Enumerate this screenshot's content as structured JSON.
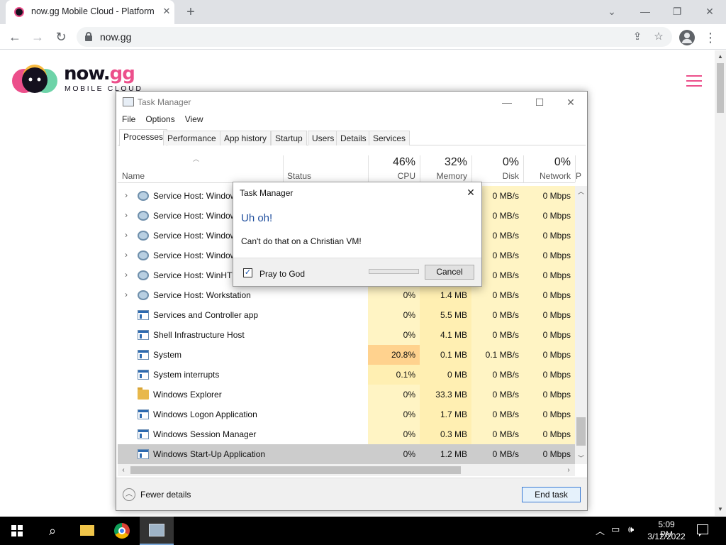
{
  "browser": {
    "tab_title": "now.gg Mobile Cloud - Platform",
    "tab_close": "✕",
    "new_tab": "+",
    "url": "now.gg",
    "window_controls": {
      "dropdown": "⌄",
      "minimize": "—",
      "restore": "❐",
      "close": "✕"
    }
  },
  "page": {
    "logo_main": "now.",
    "logo_accent": "gg",
    "logo_sub": "MOBILE CLOUD"
  },
  "task_manager": {
    "title": "Task Manager",
    "menu": [
      "File",
      "Options",
      "View"
    ],
    "tabs": [
      "Processes",
      "Performance",
      "App history",
      "Startup",
      "Users",
      "Details",
      "Services"
    ],
    "active_tab": "Processes",
    "columns": {
      "name": "Name",
      "status": "Status",
      "cpu_pct": "46%",
      "cpu": "CPU",
      "memory_pct": "32%",
      "memory": "Memory",
      "disk_pct": "0%",
      "disk": "Disk",
      "network_pct": "0%",
      "network": "Network",
      "power_cut": "P"
    },
    "rows": [
      {
        "name": "Service Host: Windows Audio",
        "icon": "gear-icon",
        "expandable": true,
        "cpu": "",
        "memory": "",
        "disk": "0 MB/s",
        "network": "0 Mbps"
      },
      {
        "name": "Service Host: Windows Event Log",
        "icon": "gear-icon",
        "expandable": true,
        "cpu": "",
        "memory": "",
        "disk": "0 MB/s",
        "network": "0 Mbps"
      },
      {
        "name": "Service Host: Windows Management",
        "icon": "gear-icon",
        "expandable": true,
        "cpu": "",
        "memory": "",
        "disk": "0 MB/s",
        "network": "0 Mbps"
      },
      {
        "name": "Service Host: Windows Push",
        "icon": "gear-icon",
        "expandable": true,
        "cpu": "",
        "memory": "",
        "disk": "0 MB/s",
        "network": "0 Mbps"
      },
      {
        "name": "Service Host: WinHTTP Web Proxy",
        "icon": "gear-icon",
        "expandable": true,
        "cpu": "",
        "memory": "",
        "disk": "0 MB/s",
        "network": "0 Mbps"
      },
      {
        "name": "Service Host: Workstation",
        "icon": "gear-icon",
        "expandable": true,
        "cpu": "0%",
        "memory": "1.4 MB",
        "disk": "0 MB/s",
        "network": "0 Mbps"
      },
      {
        "name": "Services and Controller app",
        "icon": "window-icon",
        "expandable": false,
        "cpu": "0%",
        "memory": "5.5 MB",
        "disk": "0 MB/s",
        "network": "0 Mbps"
      },
      {
        "name": "Shell Infrastructure Host",
        "icon": "window-icon",
        "expandable": false,
        "cpu": "0%",
        "memory": "4.1 MB",
        "disk": "0 MB/s",
        "network": "0 Mbps"
      },
      {
        "name": "System",
        "icon": "window-icon",
        "expandable": false,
        "cpu": "20.8%",
        "memory": "0.1 MB",
        "disk": "0.1 MB/s",
        "network": "0 Mbps"
      },
      {
        "name": "System interrupts",
        "icon": "window-icon",
        "expandable": false,
        "cpu": "0.1%",
        "memory": "0 MB",
        "disk": "0 MB/s",
        "network": "0 Mbps"
      },
      {
        "name": "Windows Explorer",
        "icon": "folder-icon",
        "expandable": false,
        "cpu": "0%",
        "memory": "33.3 MB",
        "disk": "0 MB/s",
        "network": "0 Mbps"
      },
      {
        "name": "Windows Logon Application",
        "icon": "window-icon",
        "expandable": false,
        "cpu": "0%",
        "memory": "1.7 MB",
        "disk": "0 MB/s",
        "network": "0 Mbps"
      },
      {
        "name": "Windows Session Manager",
        "icon": "window-icon",
        "expandable": false,
        "cpu": "0%",
        "memory": "0.3 MB",
        "disk": "0 MB/s",
        "network": "0 Mbps"
      },
      {
        "name": "Windows Start-Up Application",
        "icon": "window-icon",
        "expandable": false,
        "cpu": "0%",
        "memory": "1.2 MB",
        "disk": "0 MB/s",
        "network": "0 Mbps",
        "selected": true
      }
    ],
    "fewer_details": "Fewer details",
    "end_task": "End task"
  },
  "dialog": {
    "title": "Task Manager",
    "heading": "Uh oh!",
    "body": "Can't do that on a Christian VM!",
    "checkbox_label": "Pray to God",
    "checkbox_checked": true,
    "checkbox_mark": "✓",
    "progress": 0,
    "cancel": "Cancel",
    "close": "✕"
  },
  "taskbar": {
    "time": "5:09 PM",
    "date": "3/12/2022"
  }
}
